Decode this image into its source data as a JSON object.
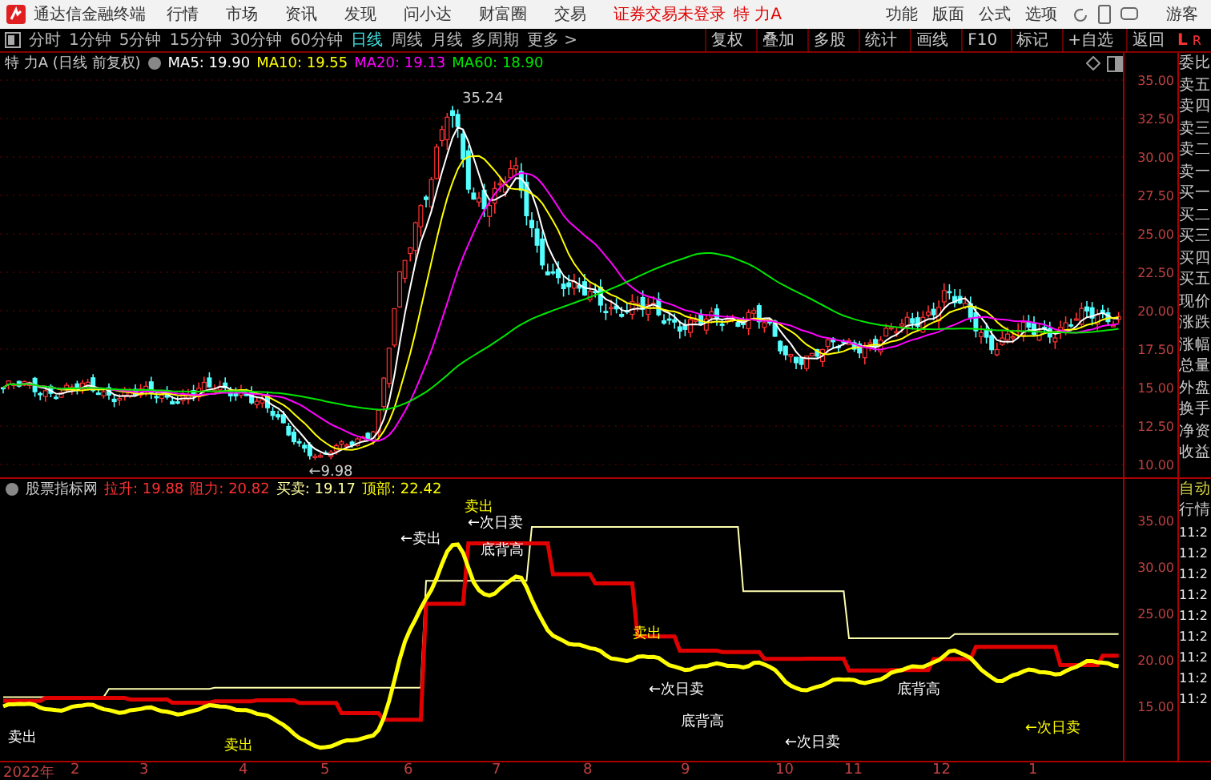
{
  "app_title": "通达信金融终端",
  "menu": [
    "行情",
    "市场",
    "资讯",
    "发现",
    "问小达",
    "财富圈",
    "交易"
  ],
  "login_status": "证券交易未登录",
  "current_stock": "特 力A",
  "right_menu": [
    "功能",
    "版面",
    "公式",
    "选项"
  ],
  "user": "游客",
  "periods": [
    {
      "label": "分时",
      "selected": false
    },
    {
      "label": "1分钟",
      "selected": false
    },
    {
      "label": "5分钟",
      "selected": false
    },
    {
      "label": "15分钟",
      "selected": false
    },
    {
      "label": "30分钟",
      "selected": false
    },
    {
      "label": "60分钟",
      "selected": false
    },
    {
      "label": "日线",
      "selected": true
    },
    {
      "label": "周线",
      "selected": false
    },
    {
      "label": "月线",
      "selected": false
    },
    {
      "label": "多周期",
      "selected": false
    },
    {
      "label": "更多 >",
      "selected": false
    }
  ],
  "tools": [
    "复权",
    "叠加",
    "多股",
    "统计",
    "画线",
    "F10",
    "标记",
    "+自选",
    "返回"
  ],
  "corner_labels": [
    "L",
    "R"
  ],
  "main_chart": {
    "title": "特 力A (日线 前复权)",
    "legend": [
      {
        "label": "MA5: 19.90",
        "color": "#ffffff"
      },
      {
        "label": "MA10: 19.55",
        "color": "#ffff00"
      },
      {
        "label": "MA20: 19.13",
        "color": "#ff00ff"
      },
      {
        "label": "MA60: 18.90",
        "color": "#00e600"
      }
    ],
    "high_label": "35.24",
    "low_label": "←9.98",
    "yticks": [
      "35.00",
      "32.50",
      "30.00",
      "27.50",
      "25.00",
      "22.50",
      "20.00",
      "17.50",
      "15.00",
      "12.50",
      "10.00"
    ]
  },
  "indicator": {
    "name": "股票指标网",
    "legend": [
      {
        "label": "拉升: 19.88",
        "color": "#ff3030"
      },
      {
        "label": "阻力: 20.82",
        "color": "#ff3030"
      },
      {
        "label": "买卖: 19.17",
        "color": "#ffffa0"
      },
      {
        "label": "顶部: 22.42",
        "color": "#ffff00"
      }
    ],
    "annotations": [
      "卖出",
      "←卖出",
      "卖出",
      "←次日卖",
      "底背高",
      "卖出",
      "←次日卖",
      "底背高",
      "卖出",
      "←次日卖",
      "底背高",
      "←次日卖"
    ],
    "yticks": [
      "35.00",
      "30.00",
      "25.00",
      "20.00",
      "15.00"
    ]
  },
  "time_axis": [
    "2022年",
    "2",
    "3",
    "4",
    "5",
    "6",
    "7",
    "8",
    "9",
    "10",
    "11",
    "12",
    "1"
  ],
  "quote_fields": [
    "委比",
    "卖五",
    "卖四",
    "卖三",
    "卖二",
    "卖一",
    "买一",
    "买二",
    "买三",
    "买四",
    "买五",
    "现价",
    "涨跌",
    "涨幅",
    "总量",
    "外盘",
    "换手",
    "净资",
    "收益"
  ],
  "mode_label": "自动",
  "trade_title": "行情",
  "trade_times": [
    "11:2",
    "11:2",
    "11:2",
    "11:2",
    "11:2",
    "11:2",
    "11:2",
    "11:2",
    "11:2"
  ]
}
